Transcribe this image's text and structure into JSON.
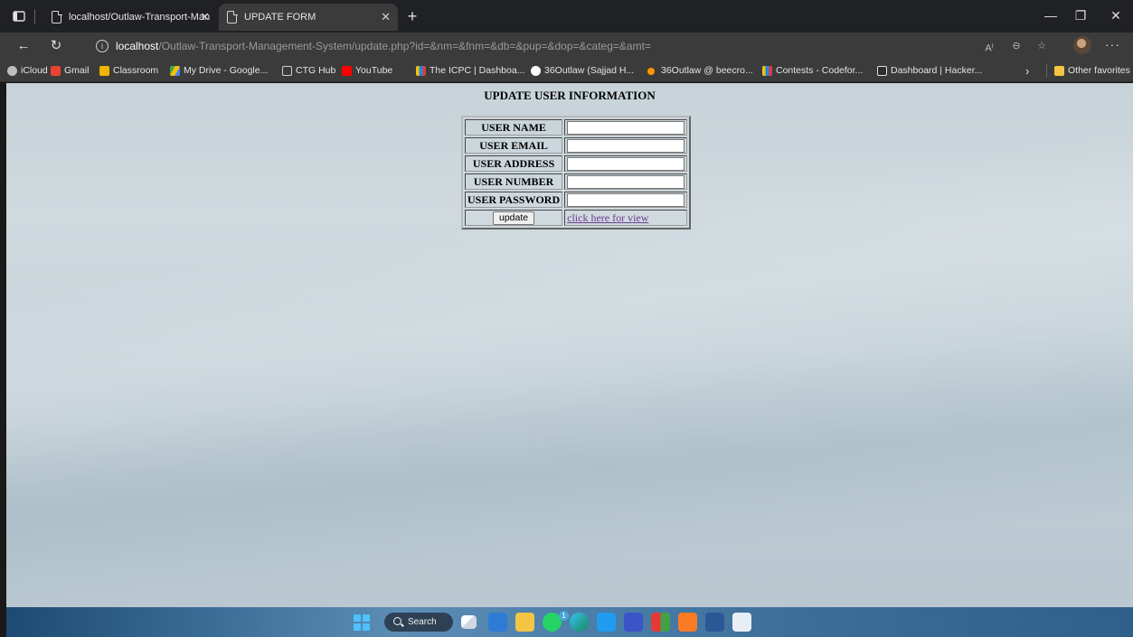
{
  "browser": {
    "tabs": [
      {
        "title": "localhost/Outlaw-Transport-Man"
      },
      {
        "title": "UPDATE FORM"
      }
    ],
    "address": {
      "host": "localhost",
      "path": "/Outlaw-Transport-Management-System/update.php?id=&nm=&fnm=&db=&pup=&dop=&categ=&amt="
    },
    "bookmarks": [
      {
        "label": "iCloud",
        "color": "#bdbdbd"
      },
      {
        "label": "Gmail",
        "color": "#ea4335"
      },
      {
        "label": "Classroom",
        "color": "#f4b400"
      },
      {
        "label": "My Drive - Google...",
        "color": "#34a853"
      },
      {
        "label": "CTG Hub",
        "color": "#cfcfcf"
      },
      {
        "label": "YouTube",
        "color": "#ff0000"
      },
      {
        "label": "The ICPC | Dashboa...",
        "color": "#1e88e5"
      },
      {
        "label": "36Outlaw (Sajjad H...",
        "color": "#ffffff"
      },
      {
        "label": "36Outlaw @ beecro...",
        "color": "#ff9800"
      },
      {
        "label": "Contests - Codefor...",
        "color": "#f4c20d"
      },
      {
        "label": "Dashboard | Hacker...",
        "color": "#e0e0e0"
      }
    ],
    "other_favorites": "Other favorites"
  },
  "page": {
    "title": "UPDATE USER INFORMATION",
    "fields": [
      {
        "label": "USER NAME",
        "value": ""
      },
      {
        "label": "USER EMAIL",
        "value": ""
      },
      {
        "label": "USER ADDRESS",
        "value": ""
      },
      {
        "label": "USER NUMBER",
        "value": ""
      },
      {
        "label": "USER PASSWORD",
        "value": ""
      }
    ],
    "update_button": "update",
    "view_link": "click here for view"
  },
  "taskbar": {
    "search_label": "Search",
    "notification_count": "1"
  }
}
